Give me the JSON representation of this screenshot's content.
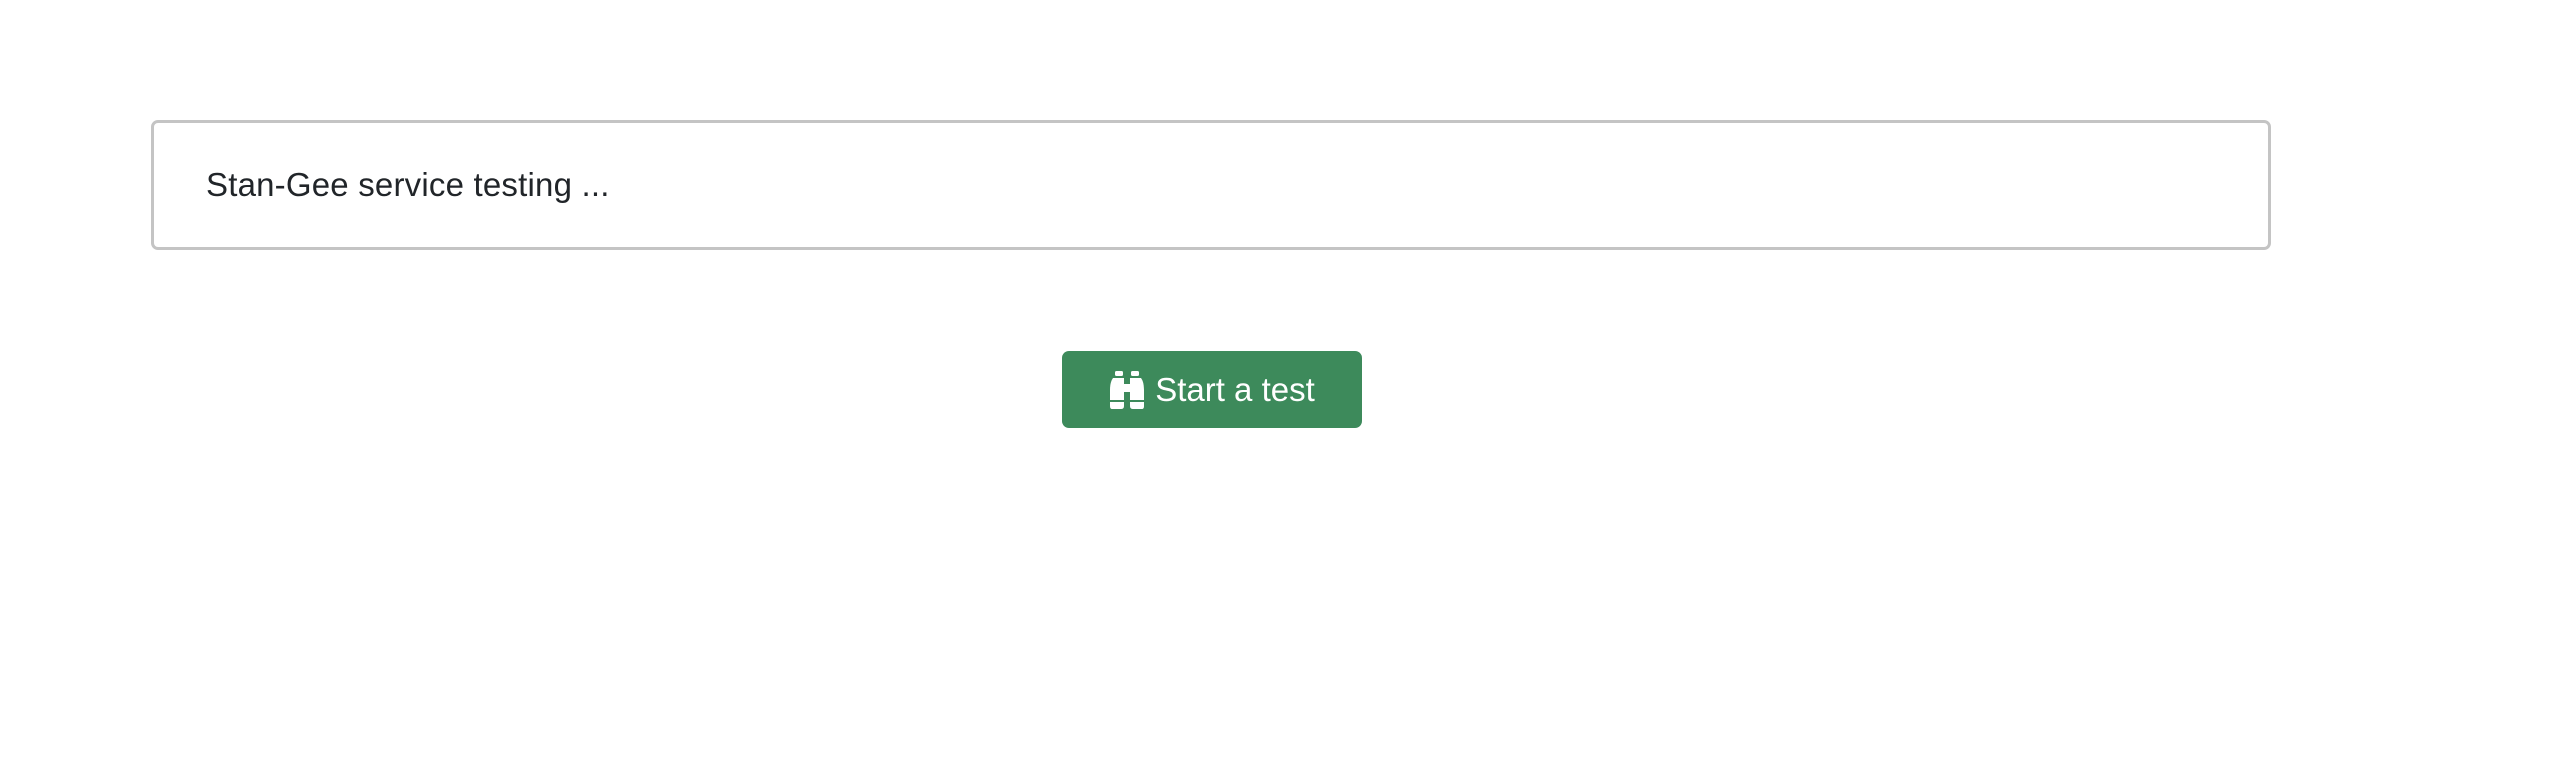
{
  "status": {
    "message": "Stan-Gee service testing ..."
  },
  "actions": {
    "start_button": {
      "label": "Start a test",
      "icon": "binoculars-icon",
      "color": "#3d8a5b"
    }
  },
  "colors": {
    "box_border": "#c4c4c4",
    "text": "#212529",
    "button_text": "#ffffff"
  }
}
